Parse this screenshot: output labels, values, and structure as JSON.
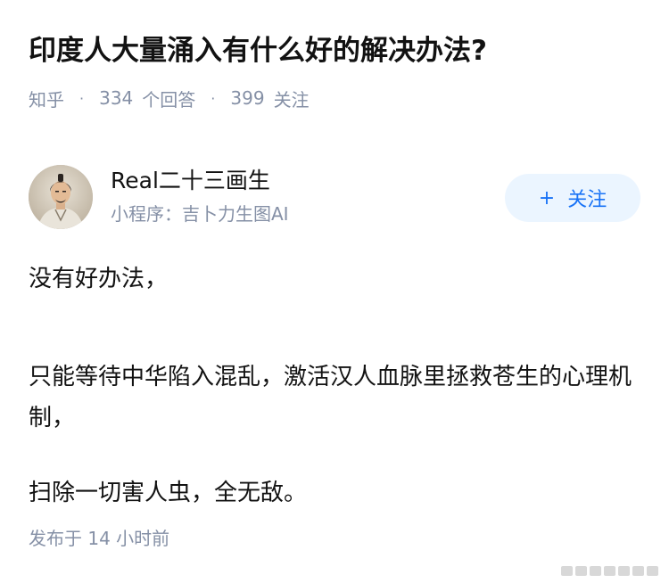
{
  "question": {
    "title": "印度人大量涌入有什么好的解决办法?"
  },
  "meta": {
    "source": "知乎",
    "answers_count": "334",
    "answers_label": "个回答",
    "followers_count": "399",
    "followers_label": "关注"
  },
  "author": {
    "name": "Real二十三画生",
    "subtitle": "小程序：吉卜力生图AI",
    "follow_label": "关注",
    "follow_icon": "plus-icon"
  },
  "content": {
    "paragraphs": [
      "没有好办法，",
      "只能等待中华陷入混乱，激活汉人血脉里拯救苍生的心理机制，",
      "扫除一切害人虫，全无敌。"
    ]
  },
  "footer": {
    "published": "发布于  14 小时前"
  },
  "colors": {
    "accent": "#1772f6",
    "follow_bg": "#ebf5ff",
    "meta_gray": "#8590a6",
    "text": "#121212"
  }
}
